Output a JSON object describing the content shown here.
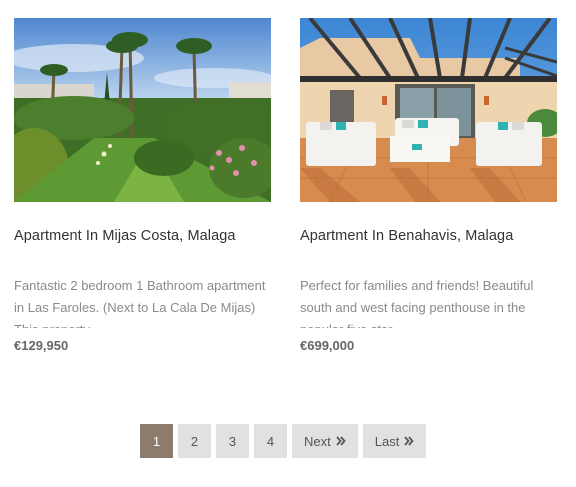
{
  "listings": [
    {
      "title": "Apartment In Mijas Costa, Malaga",
      "description": "Fantastic 2 bedroom 1 Bathroom apartment in Las Faroles. (Next to La Cala De Mijas) This property",
      "price": "€129,950"
    },
    {
      "title": "Apartment In Benahavis, Malaga",
      "description": "Perfect for families and friends! Beautiful south and west facing penthouse in the popular five star",
      "price": "€699,000"
    }
  ],
  "pagination": {
    "pages": [
      "1",
      "2",
      "3",
      "4"
    ],
    "current_page": "1",
    "next_label": "Next",
    "last_label": "Last"
  },
  "colors": {
    "active_page": "#8d7b6b",
    "page_button": "#e1e1e1",
    "text_muted": "#8a8a8a"
  }
}
